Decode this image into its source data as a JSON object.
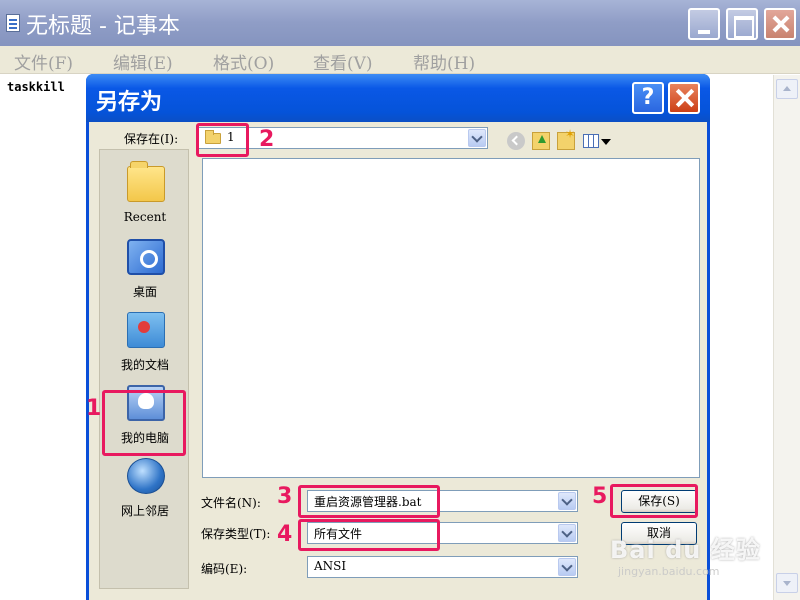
{
  "notepad": {
    "title": "无标题 - 记事本",
    "menus": [
      "文件(F)",
      "编辑(E)",
      "格式(O)",
      "查看(V)",
      "帮助(H)"
    ],
    "content": "taskkill"
  },
  "dialog": {
    "title": "另存为",
    "help_label": "?",
    "save_in_label": "保存在(I):",
    "save_in_value": "1",
    "places": [
      {
        "label": "Recent",
        "icon": "recent-folder-icon"
      },
      {
        "label": "桌面",
        "icon": "desktop-icon"
      },
      {
        "label": "我的文档",
        "icon": "my-documents-icon"
      },
      {
        "label": "我的电脑",
        "icon": "my-computer-icon"
      },
      {
        "label": "网上邻居",
        "icon": "network-places-icon"
      }
    ],
    "filename_label": "文件名(N):",
    "filename_value": "重启资源管理器.bat",
    "filetype_label": "保存类型(T):",
    "filetype_value": "所有文件",
    "encoding_label": "编码(E):",
    "encoding_value": "ANSI",
    "save_button": "保存(S)",
    "cancel_button": "取消"
  },
  "annotations": {
    "step1": "1",
    "step2": "2",
    "step3": "3",
    "step4": "4",
    "step5": "5",
    "color": "#e8195f"
  },
  "watermark": {
    "main": "Bai du 经验",
    "sub": "jingyan.baidu.com"
  }
}
